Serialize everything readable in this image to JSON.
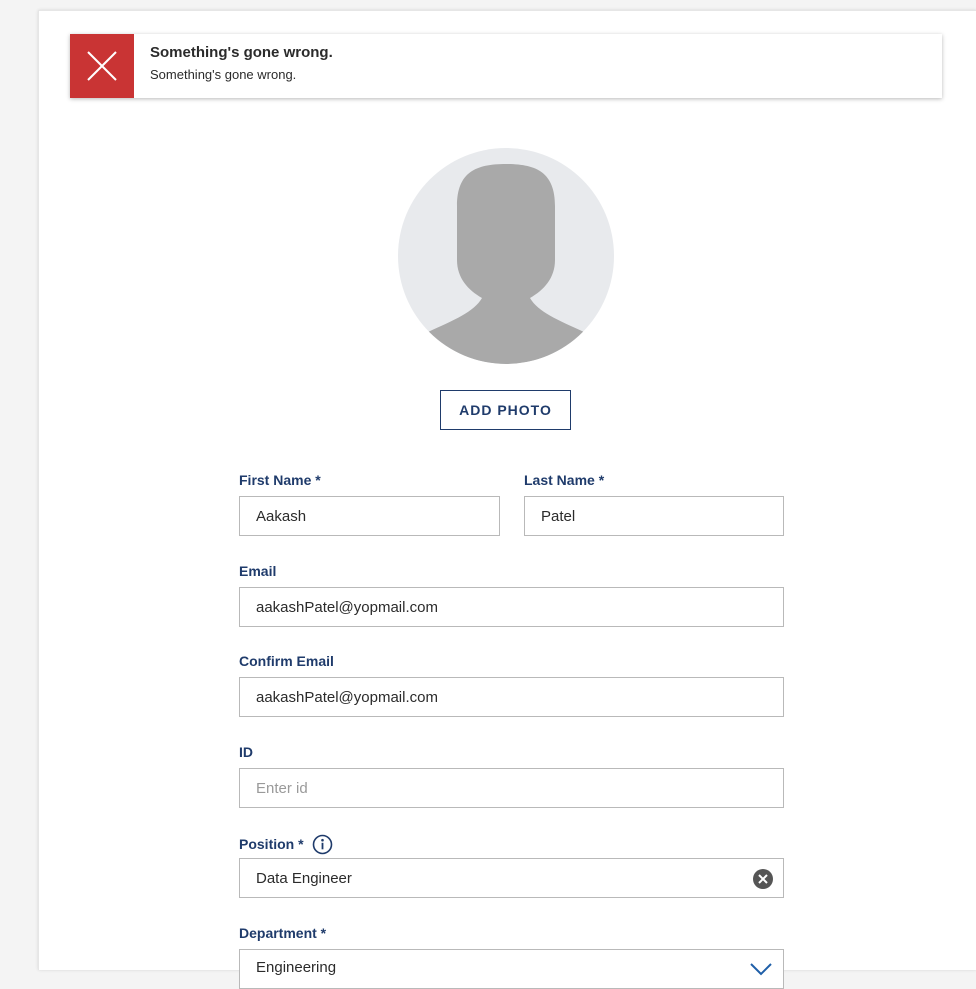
{
  "toast": {
    "title": "Something's gone wrong.",
    "message": "Something's gone wrong.",
    "icon": "close-icon",
    "color": "#c93434"
  },
  "avatar": {
    "icon": "person-silhouette-icon"
  },
  "add_photo_label": "ADD PHOTO",
  "form": {
    "first_name": {
      "label": "First Name *",
      "value": "Aakash"
    },
    "last_name": {
      "label": "Last Name *",
      "value": "Patel"
    },
    "email": {
      "label": "Email",
      "value": "aakashPatel@yopmail.com"
    },
    "confirm_email": {
      "label": "Confirm Email",
      "value": "aakashPatel@yopmail.com"
    },
    "id": {
      "label": "ID",
      "value": "",
      "placeholder": "Enter id"
    },
    "position": {
      "label": "Position *",
      "value": "Data Engineer",
      "info_icon": "info-icon",
      "clear_icon": "clear-icon"
    },
    "department": {
      "label": "Department *",
      "value": "Engineering",
      "chevron_icon": "chevron-down-icon"
    }
  },
  "colors": {
    "label": "#1f3b6b",
    "error": "#c93434",
    "border": "#b9b9b9"
  }
}
